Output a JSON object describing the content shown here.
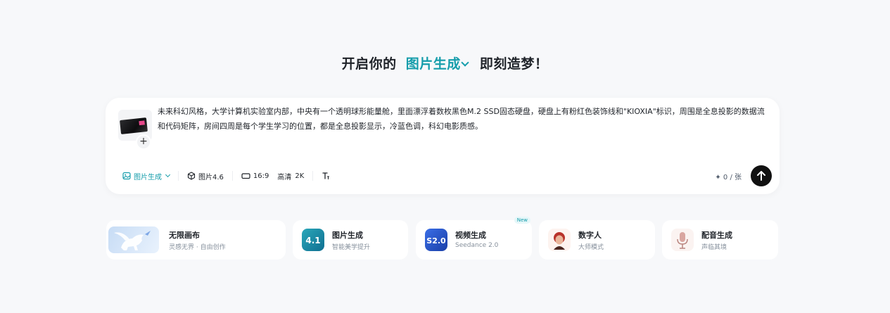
{
  "header": {
    "prefix": "开启你的",
    "mode": "图片生成",
    "suffix": "即刻造梦！"
  },
  "composer": {
    "prompt": "未来科幻风格，大学计算机实验室内部，中央有一个透明球形能量舱，里面漂浮着数枚黑色M.2 SSD固态硬盘，硬盘上有粉红色装饰线和\"KIOXIA\"标识，周围是全息投影的数据流和代码矩阵，房间四周是每个学生学习的位置，都是全息投影显示，冷蓝色调，科幻电影质感。",
    "add_icon": "+",
    "toolbar": {
      "mode_label": "图片生成",
      "model_label": "图片4.6",
      "ratio_label": "16:9",
      "quality_label": "高清",
      "resolution_label": "2K"
    },
    "quota": "0 / 张"
  },
  "cards": [
    {
      "title": "无限画布",
      "subtitle": "灵感无界 · 自由创作",
      "icon": "pegasus-icon"
    },
    {
      "title": "图片生成",
      "subtitle": "智能美学提升",
      "icon": "image-4-1-icon"
    },
    {
      "title": "视频生成",
      "subtitle": "Seedance 2.0",
      "icon": "seedance-icon",
      "badge": "New"
    },
    {
      "title": "数字人",
      "subtitle": "大师模式",
      "icon": "avatar-icon"
    },
    {
      "title": "配音生成",
      "subtitle": "声临其境",
      "icon": "microphone-icon"
    }
  ],
  "colors": {
    "accent": "#159dab",
    "background": "#f7f8fa",
    "send_button": "#111111"
  }
}
